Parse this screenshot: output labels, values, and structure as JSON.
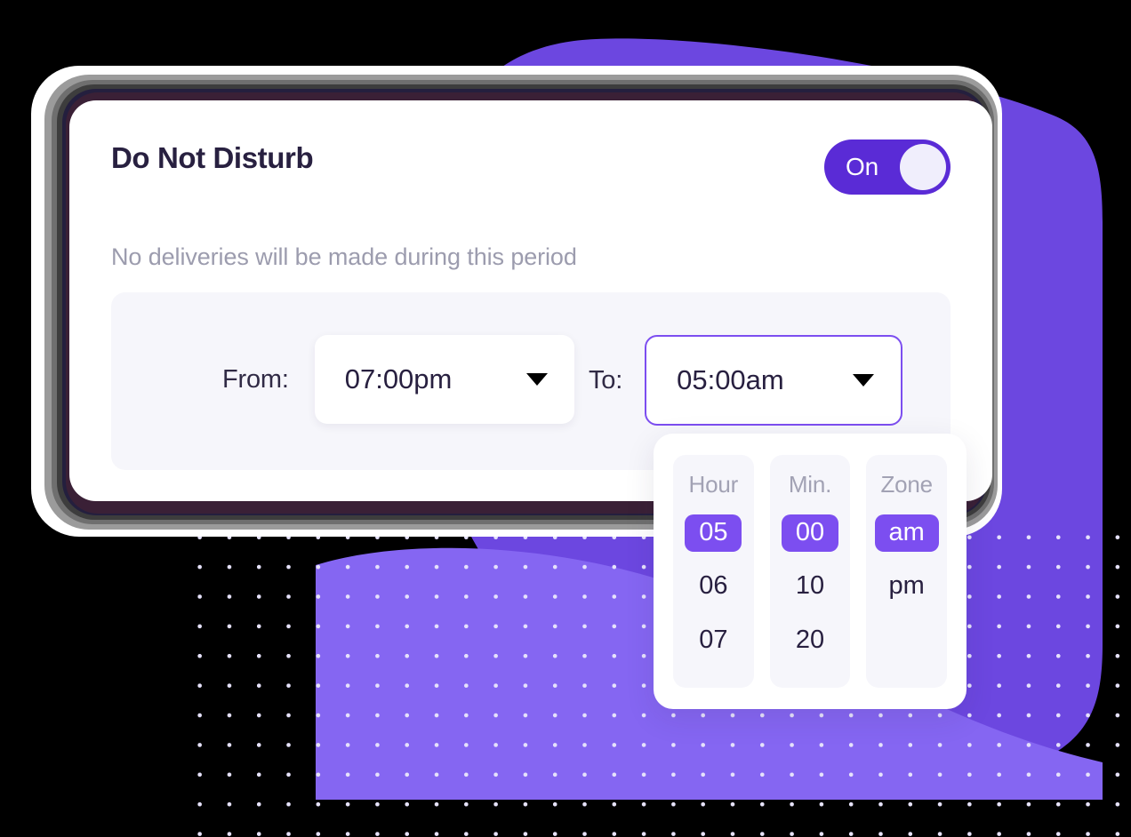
{
  "card": {
    "title": "Do Not Disturb",
    "subtitle": "No deliveries will be made during this period",
    "toggle": {
      "state_label": "On",
      "is_on": true
    }
  },
  "schedule": {
    "from": {
      "label": "From:",
      "value": "07:00pm",
      "caret_icon": "chevron-down-icon",
      "focused": false
    },
    "to": {
      "label": "To:",
      "value": "05:00am",
      "caret_icon": "chevron-down-icon",
      "focused": true
    }
  },
  "picker": {
    "columns": [
      {
        "header": "Hour",
        "options": [
          "05",
          "06",
          "07"
        ],
        "selected": "05"
      },
      {
        "header": "Min.",
        "options": [
          "00",
          "10",
          "20"
        ],
        "selected": "00"
      },
      {
        "header": "Zone",
        "options": [
          "am",
          "pm"
        ],
        "selected": "am"
      }
    ]
  },
  "colors": {
    "accent": "#7c4ef0",
    "toggle_on": "#5a2bd6",
    "blob_dark": "#6c47e0",
    "blob_light": "#8566f2",
    "title_text": "#282040",
    "muted_text": "#9c9cae",
    "panel_bg": "#f6f6fb",
    "dot": "#e6e2fb"
  }
}
